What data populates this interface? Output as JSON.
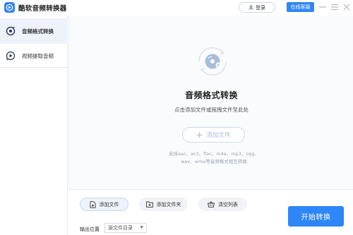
{
  "window": {
    "title": "酷软音频转换器",
    "login_label": "登录",
    "service_label": "在线客服"
  },
  "sidebar": {
    "items": [
      {
        "label": "音频格式转换",
        "icon": "audio-convert-icon",
        "active": true
      },
      {
        "label": "视频提取音频",
        "icon": "video-extract-icon",
        "active": false
      }
    ]
  },
  "main": {
    "title": "音频格式转换",
    "subtitle": "点击添加文件或拖拽文件至此处",
    "add_file_label": "添加文件",
    "formats_line1": "支持aac、ac3、flac、m4a、mp3、ogg、",
    "formats_line2": "wav、wma等音频格式相互转换"
  },
  "bottom": {
    "add_file_label": "添加文件",
    "add_folder_label": "添加文件夹",
    "clear_list_label": "清空列表",
    "start_label": "开始转换",
    "output_label": "输出位置",
    "output_value": "源文件目录"
  },
  "colors": {
    "accent": "#2f86f6",
    "active_bg": "#eef3fb"
  }
}
